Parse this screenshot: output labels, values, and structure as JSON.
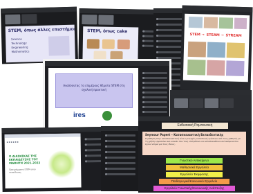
{
  "panels": {
    "p1": {
      "slide_title": "STEM, όπως άλλες επιστήμες:",
      "slide_words": [
        "Science",
        "Technology",
        "Engineering",
        "Mathematics"
      ]
    },
    "p2": {
      "slide_title": "STEM, όπως cake"
    },
    "p4": {
      "slide_labels": [
        "STEM",
        "STEAM",
        "STREAM"
      ]
    },
    "p5": {
      "slide_text": "Αναλύοντας τα επιμέρους θέματα STEM στη σχολική πρακτική",
      "logo": "ires"
    },
    "p7": {
      "slide_title": "Ο ΔΙΑΣΚΕΚΑΣ ΤΗΣ ΕΚΠΑΙΔΕΥΣΗΣ ΤΟΥ ΜΑΘΗΤΗ 2021-2022",
      "subtitle": "Προγράμματα STEM στην εκπαίδευση"
    }
  },
  "notes": {
    "title": "Εκθεσιακή Ραμπουτική",
    "box_title": "Seymour Papert – Κατασκευαστική Εκπαιδευτικής",
    "box_text": "Η μάθηση στην κατασκευαστική είναι η ενεργός κατασκευή γνώσεων από τους μαθητές με τη χρήση εργαλείων και υλικών που τους επιτρέπουν να κατασκευάσουν αντικείμενα που έχουν νόημα για τους ίδιους.",
    "bars": [
      {
        "label": "Γνωστικό Αντικείμενο",
        "color": "#9ee84a"
      },
      {
        "label": "Μαθησιακά Εργαλεία",
        "color": "#f2c23c"
      },
      {
        "label": "Εργαλεία Έκφρασης",
        "color": "#f0f04a"
      },
      {
        "label": "Παιδαγωγικό/Κοινωνικό Εργαλείο",
        "color": "#f39a4a"
      },
      {
        "label": "Εργαλείο Γνωστικής/Κοινωνικής Ανάπτυξης",
        "color": "#e25ad6"
      }
    ]
  },
  "colors": {
    "zoom_bg": "#1b1c1f",
    "accent": "#5b4bd6"
  }
}
